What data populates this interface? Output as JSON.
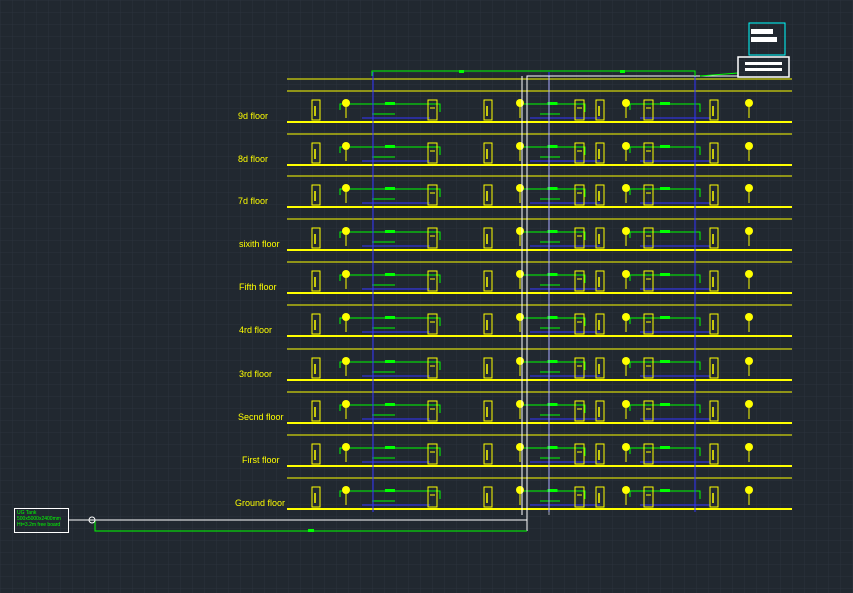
{
  "diagram": {
    "colors": {
      "background": "#212830",
      "grid": "#2b3440",
      "floor_line": "#ffff00",
      "supply_pipe": "#00ff00",
      "riser": "#ffffff",
      "drain": "#3333ff",
      "fixture": "#ffff00",
      "tank": "#00ffff"
    },
    "floors": [
      {
        "label": "9d floor"
      },
      {
        "label": "8d floor"
      },
      {
        "label": "7d floor"
      },
      {
        "label": "sixith floor"
      },
      {
        "label": "Fifth floor"
      },
      {
        "label": "4rd floor"
      },
      {
        "label": "3rd floor"
      },
      {
        "label": "Secnd floor"
      },
      {
        "label": "First floor"
      },
      {
        "label": "Ground floor"
      }
    ],
    "ug_tank": {
      "title": "UG Tank",
      "line1": "500x5000x2400mm",
      "line2": "Ht=3.2m free board"
    }
  }
}
